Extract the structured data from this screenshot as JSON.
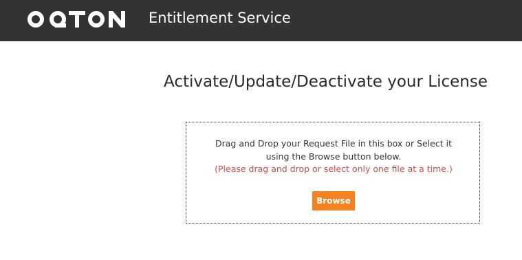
{
  "header": {
    "logo_text": "OQTON",
    "service_title": "Entitlement Service",
    "background_color": "#333333"
  },
  "main": {
    "heading": "Activate/Update/Deactivate your License",
    "drop_zone": {
      "line1": "Drag and Drop your Request File in this box or Select it",
      "line2": "using the Browse button below.",
      "note": "(Please drag and drop or select only one file at a time.)",
      "note_color": "#c0504d",
      "browse_label": "Browse",
      "browse_color": "#f58220"
    }
  }
}
